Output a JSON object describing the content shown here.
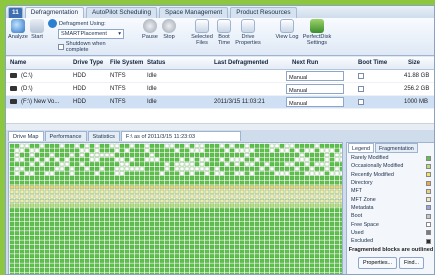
{
  "app": {
    "tab_number": "11"
  },
  "tabs": [
    "Defragmentation",
    "AutoPilot Scheduling",
    "Space Management",
    "Product Resources"
  ],
  "ribbon": {
    "analyze": "Analyze",
    "start": "Start",
    "group_label": "Defragment Using:",
    "method": "SMARTPlacement",
    "shutdown": "Shutdown when complete",
    "pause": "Pause",
    "stop": "Stop",
    "selected_files": "Selected Files",
    "boot_time": "Boot Time",
    "drive_properties": "Drive Properties",
    "view_log": "View Log",
    "perfectdisk_settings": "PerfectDisk Settings"
  },
  "grid": {
    "headers": [
      "Name",
      "Drive Type",
      "File System",
      "Status",
      "Last Defragmented",
      "Next Run",
      "Boot Time",
      "Size"
    ],
    "rows": [
      {
        "name": "(C:\\)",
        "type": "HDD",
        "fs": "NTFS",
        "status": "Idle",
        "last": "",
        "next": "Manual",
        "size": "41.88 GB"
      },
      {
        "name": "(D:\\)",
        "type": "HDD",
        "fs": "NTFS",
        "status": "Idle",
        "last": "",
        "next": "Manual",
        "size": "256.2 GB"
      },
      {
        "name": "(F:\\) New Vo...",
        "type": "HDD",
        "fs": "NTFS",
        "status": "Idle",
        "last": "2011/3/15 11:03:21",
        "next": "Manual",
        "size": "1000 MB"
      }
    ]
  },
  "drive_tabs": [
    "Drive Map",
    "Performance",
    "Statistics"
  ],
  "drive_map_date": "F:\\ as of 2011/3/15 11:23:03",
  "legend": {
    "tabs": [
      "Legend",
      "Fragmentation"
    ],
    "items": [
      {
        "label": "Rarely Modified",
        "color": "#5cc24a"
      },
      {
        "label": "Occasionally Modified",
        "color": "#b7df7c"
      },
      {
        "label": "Recently Modified",
        "color": "#f5e35c"
      },
      {
        "label": "Directory",
        "color": "#f0a64a"
      },
      {
        "label": "MFT",
        "color": "#e9d27a"
      },
      {
        "label": "MFT Zone",
        "color": "#f2e9b8"
      },
      {
        "label": "Metadata",
        "color": "#9aa3e6"
      },
      {
        "label": "Boot",
        "color": "#c8c8c8"
      },
      {
        "label": "Free Space",
        "color": "#ffffff"
      },
      {
        "label": "Used",
        "color": "#7b7b7b"
      },
      {
        "label": "Excluded",
        "color": "#2d2d2d"
      }
    ],
    "note": "Fragmented blocks are outlined",
    "properties_button": "Properties...",
    "find_button": "Find..."
  }
}
